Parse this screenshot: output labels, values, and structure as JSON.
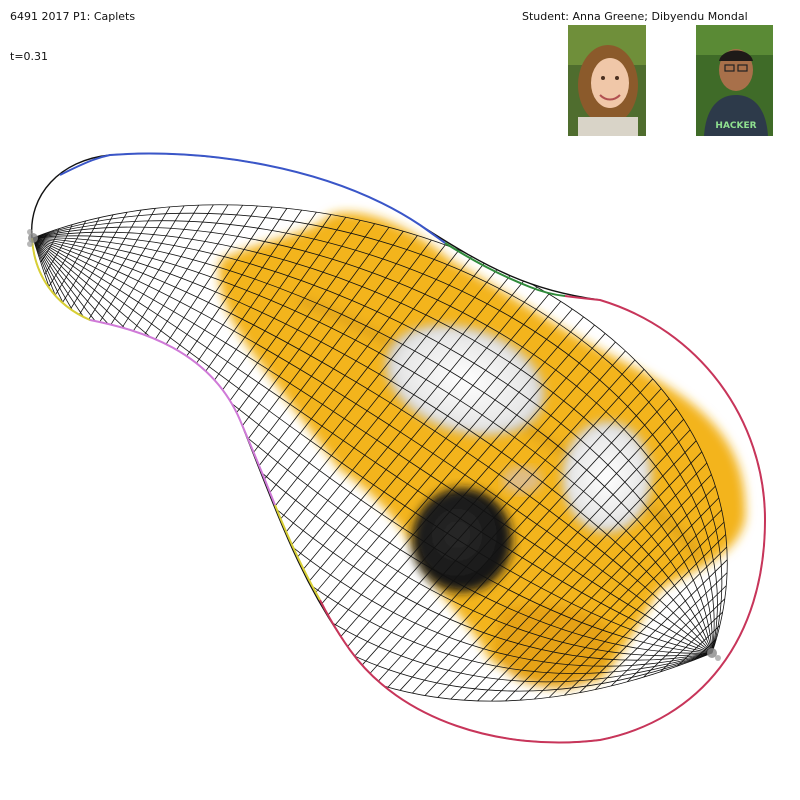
{
  "header": {
    "title": "6491 2017 P1: Caplets",
    "time_label": "t=0.31",
    "student_label": "Student: Anna Greene; Dibyendu Mondal"
  },
  "photos": [
    {
      "name": "student-photo-anna",
      "desc_icon": "portrait-woman-icon"
    },
    {
      "name": "student-photo-dibyendu",
      "desc_icon": "portrait-man-icon",
      "shirt_text": "HACKER"
    }
  ],
  "colors": {
    "grid": "#111111",
    "edge_blue": "#3a56c8",
    "edge_green": "#2f8a3a",
    "edge_red": "#c8355a",
    "edge_yellow": "#d8cf35",
    "edge_pink": "#d07ad8",
    "emoji_yellow": "#f3b41f",
    "emoji_dark": "#c48a0c"
  }
}
